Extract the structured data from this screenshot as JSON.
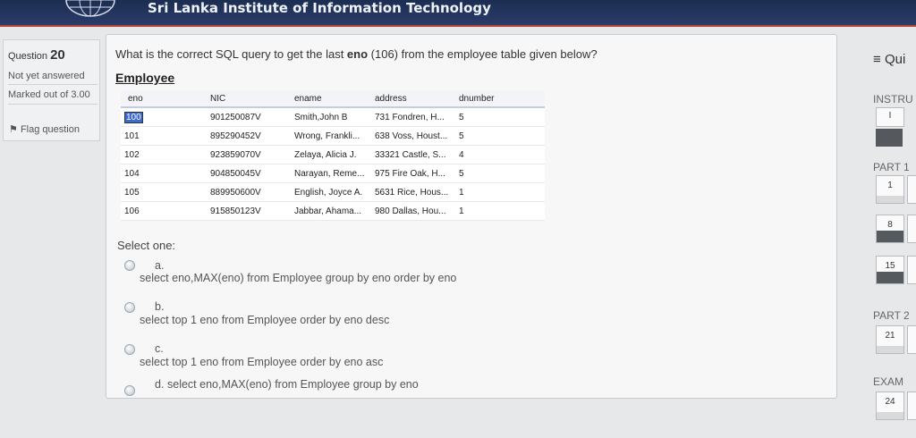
{
  "header": {
    "site_title": "Sri Lanka Institute of Information Technology"
  },
  "question_info": {
    "label": "Question",
    "number": "20",
    "status": "Not yet answered",
    "marked_out_of": "Marked out of 3.00",
    "flag_label": "Flag question"
  },
  "question": {
    "text_prefix": "What is the correct SQL query to get the last ",
    "text_bold": "eno",
    "text_suffix": " (106) from the employee table given below?",
    "table_title": "Employee",
    "columns": [
      "eno",
      "NIC",
      "ename",
      "address",
      "dnumber"
    ],
    "rows": [
      [
        "100",
        "901250087V",
        "Smith,John B",
        "731 Fondren, H...",
        "5"
      ],
      [
        "101",
        "895290452V",
        "Wrong, Frankli...",
        "638 Voss, Houst...",
        "5"
      ],
      [
        "102",
        "923859070V",
        "Zelaya, Alicia J.",
        "33321 Castle, S...",
        "4"
      ],
      [
        "104",
        "904850045V",
        "Narayan, Reme...",
        "975 Fire Oak, H...",
        "5"
      ],
      [
        "105",
        "889950600V",
        "English, Joyce A.",
        "5631 Rice, Hous...",
        "1"
      ],
      [
        "106",
        "915850123V",
        "Jabbar, Ahama...",
        "980 Dallas, Hou...",
        "1"
      ]
    ],
    "select_one": "Select one:",
    "options": [
      {
        "letter": "a.",
        "text": "select eno,MAX(eno) from Employee group by eno order by eno"
      },
      {
        "letter": "b.",
        "text": "select top 1 eno from Employee order by eno desc"
      },
      {
        "letter": "c.",
        "text": "select top 1 eno from Employee order by eno asc"
      },
      {
        "letter": "d.",
        "text": "select eno,MAX(eno) from Employee group by eno"
      }
    ]
  },
  "quiz_nav": {
    "title": "Qui",
    "instructions": "INSTRU",
    "instr_btn": "I",
    "part1": "PART 1",
    "part2": "PART 2",
    "exam": "EXAM",
    "buttons": [
      "1",
      "8",
      "15",
      "21",
      "24"
    ]
  },
  "colors": {
    "header_bg": "#1c2d52",
    "accent_line": "#b5433a",
    "selected_cell": "#3c6ad0"
  }
}
